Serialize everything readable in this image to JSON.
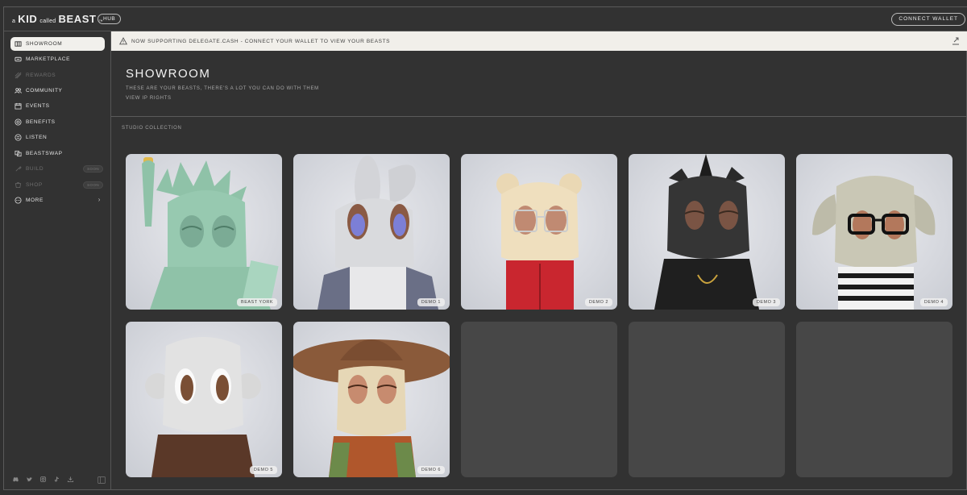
{
  "header": {
    "logo": {
      "a": "a",
      "kid": "KID",
      "called": "called",
      "beast": "BEAST",
      "tm": "™"
    },
    "hub_label": "HUB",
    "connect_label": "CONNECT WALLET"
  },
  "sidebar": {
    "items": [
      {
        "label": "SHOWROOM",
        "icon": "showroom-icon",
        "state": "active"
      },
      {
        "label": "MARKETPLACE",
        "icon": "marketplace-icon",
        "state": "normal"
      },
      {
        "label": "REWARDS",
        "icon": "rewards-icon",
        "state": "disabled"
      },
      {
        "label": "COMMUNITY",
        "icon": "community-icon",
        "state": "normal"
      },
      {
        "label": "EVENTS",
        "icon": "events-icon",
        "state": "normal"
      },
      {
        "label": "BENEFITS",
        "icon": "benefits-icon",
        "state": "normal"
      },
      {
        "label": "LISTEN",
        "icon": "listen-icon",
        "state": "normal"
      },
      {
        "label": "BEASTSWAP",
        "icon": "beastswap-icon",
        "state": "normal"
      },
      {
        "label": "BUILD",
        "icon": "build-icon",
        "state": "disabled",
        "badge": "SOON"
      },
      {
        "label": "SHOP",
        "icon": "shop-icon",
        "state": "disabled",
        "badge": "SOON"
      },
      {
        "label": "MORE",
        "icon": "more-icon",
        "state": "normal",
        "chevron": "›"
      }
    ],
    "social_icons": [
      "discord-icon",
      "twitter-icon",
      "instagram-icon",
      "tiktok-icon",
      "download-icon"
    ]
  },
  "banner": {
    "text": "NOW SUPPORTING DELEGATE.CASH - CONNECT YOUR WALLET TO VIEW YOUR BEASTS"
  },
  "main": {
    "title": "SHOWROOM",
    "subtitle": "THESE ARE YOUR BEASTS, THERE'S A LOT YOU CAN DO WITH THEM",
    "ip_link": "VIEW IP RIGHTS",
    "section_title": "STUDIO COLLECTION",
    "cards": [
      {
        "label": "BEAST YORK",
        "character": "liberty-beast"
      },
      {
        "label": "DEMO 1",
        "character": "rabbit-beast"
      },
      {
        "label": "DEMO 2",
        "character": "bear-beast"
      },
      {
        "label": "DEMO 3",
        "character": "black-cat-beast"
      },
      {
        "label": "DEMO 4",
        "character": "floppy-ear-beast"
      },
      {
        "label": "DEMO 5",
        "character": "monkey-beast"
      },
      {
        "label": "DEMO 6",
        "character": "cowboy-hat-beast"
      },
      {
        "label": "",
        "character": ""
      },
      {
        "label": "",
        "character": ""
      },
      {
        "label": "",
        "character": ""
      }
    ]
  },
  "colors": {
    "background": "#323232",
    "active_nav": "#f1f0ec",
    "banner": "#f1efea",
    "empty_card": "#474747",
    "liberty_green": "#8fc2a8"
  }
}
